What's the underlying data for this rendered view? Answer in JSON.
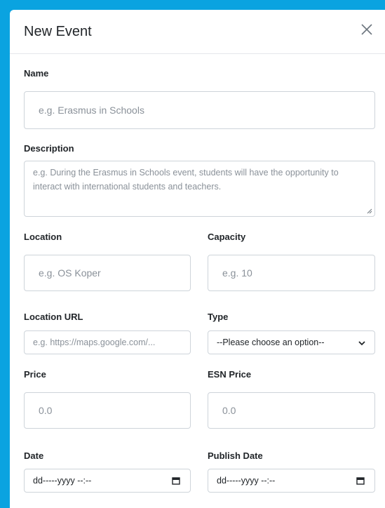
{
  "modal": {
    "title": "New Event"
  },
  "form": {
    "name": {
      "label": "Name",
      "placeholder": "e.g. Erasmus in Schools"
    },
    "description": {
      "label": "Description",
      "placeholder": "e.g. During the Erasmus in Schools event, students will have the opportunity to interact with international students and teachers."
    },
    "location": {
      "label": "Location",
      "placeholder": "e.g. OS Koper"
    },
    "capacity": {
      "label": "Capacity",
      "placeholder": "e.g. 10"
    },
    "location_url": {
      "label": "Location URL",
      "placeholder": "e.g. https://maps.google.com/..."
    },
    "type": {
      "label": "Type",
      "selected": "--Please choose an option--"
    },
    "price": {
      "label": "Price",
      "placeholder": "0.0"
    },
    "esn_price": {
      "label": "ESN Price",
      "placeholder": "0.0"
    },
    "date": {
      "label": "Date",
      "placeholder": "dd-----yyyy --:--"
    },
    "publish_date": {
      "label": "Publish Date",
      "placeholder": "dd-----yyyy --:--"
    }
  },
  "icons": {
    "close": "close-icon",
    "type_dropdown": "chevron-down-icon",
    "date_picker": "calendar-icon",
    "publish_date_picker": "calendar-icon",
    "textarea_resize": "resize-handle-icon"
  },
  "colors": {
    "background_accent": "#0aa3e0",
    "text": "#212529",
    "placeholder": "#8a9199",
    "border": "#ced4da"
  }
}
